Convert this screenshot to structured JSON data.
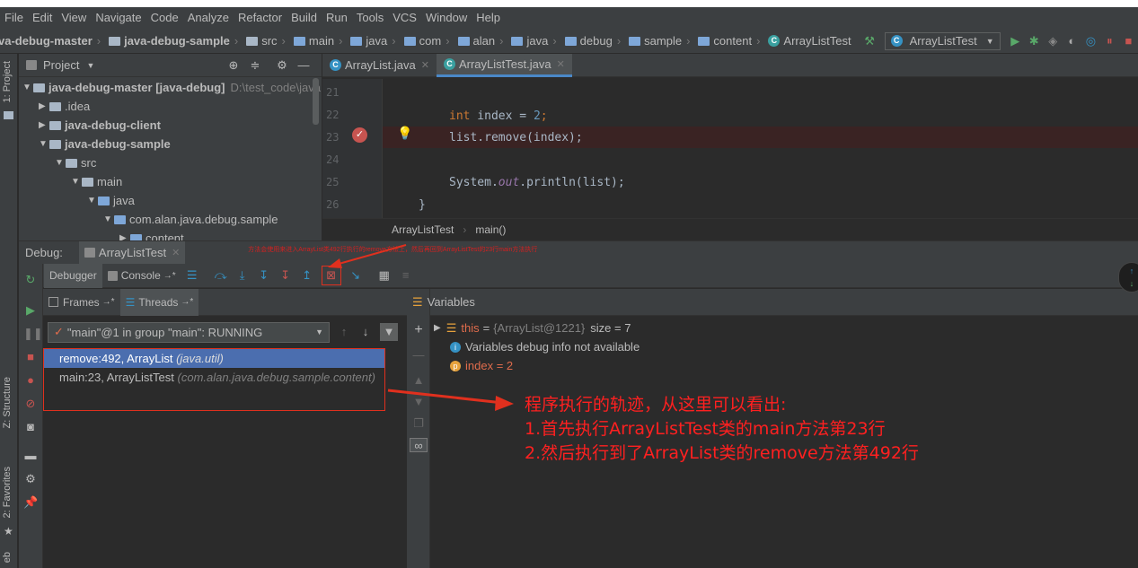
{
  "menu": [
    "File",
    "Edit",
    "View",
    "Navigate",
    "Code",
    "Analyze",
    "Refactor",
    "Build",
    "Run",
    "Tools",
    "VCS",
    "Window",
    "Help"
  ],
  "breadcrumbs": [
    "va-debug-master",
    "java-debug-sample",
    "src",
    "main",
    "java",
    "com",
    "alan",
    "java",
    "debug",
    "sample",
    "content",
    "ArrayListTest"
  ],
  "run_config": "ArrayListTest",
  "project_panel": {
    "title": "Project",
    "tree": [
      {
        "label": "java-debug-master [java-debug]",
        "suffix": "D:\\test_code\\java",
        "indent": 0,
        "expanded": true,
        "bold": true
      },
      {
        "label": ".idea",
        "indent": 1,
        "expanded": false,
        "bold": false
      },
      {
        "label": "java-debug-client",
        "indent": 1,
        "expanded": false,
        "bold": true
      },
      {
        "label": "java-debug-sample",
        "indent": 1,
        "expanded": true,
        "bold": true
      },
      {
        "label": "src",
        "indent": 2,
        "expanded": true,
        "bold": false
      },
      {
        "label": "main",
        "indent": 3,
        "expanded": true,
        "bold": false
      },
      {
        "label": "java",
        "indent": 4,
        "expanded": true,
        "bold": false
      },
      {
        "label": "com.alan.java.debug.sample",
        "indent": 5,
        "expanded": true,
        "bold": false
      },
      {
        "label": "content",
        "indent": 6,
        "expanded": false,
        "bold": false
      }
    ]
  },
  "editor": {
    "tabs": [
      "ArrayList.java",
      "ArrayListTest.java"
    ],
    "line_numbers": [
      "21",
      "22",
      "23",
      "24",
      "25",
      "26"
    ],
    "code": {
      "l22_kw": "int",
      "l22_rest": " index = ",
      "l22_num": "2",
      "l22_end": ";",
      "l23": "list.remove(index);",
      "l25_a": "System.",
      "l25_out": "out",
      "l25_b": ".println(list);",
      "l26": "}"
    },
    "crumb_class": "ArrayListTest",
    "crumb_method": "main()"
  },
  "debug": {
    "label": "Debug:",
    "session": "ArrayListTest",
    "toolbar_tabs": [
      "Debugger",
      "Console"
    ],
    "frames_tab": "Frames",
    "threads_tab": "Threads",
    "thread": "\"main\"@1 in group \"main\": RUNNING",
    "frames": [
      {
        "method": "remove:492, ArrayList",
        "pkg": "(java.util)"
      },
      {
        "method": "main:23, ArrayListTest",
        "pkg": "(com.alan.java.debug.sample.content)"
      }
    ],
    "variables_title": "Variables",
    "variables": {
      "this_name": "this",
      "this_value": "{ArrayList@1221}",
      "this_size": "size = 7",
      "info": "Variables debug info not available",
      "index": "index = 2"
    }
  },
  "side_tabs": [
    "1: Project",
    "Z: Structure",
    "2: Favorites",
    "eb"
  ],
  "annotations": {
    "small_note": "方法会使用来进入ArrayList类492行执行的remove方法上，然后再回到ArrayListTest的23行main方法执行",
    "line1": "程序执行的轨迹，从这里可以看出:",
    "line2": "1.首先执行ArrayListTest类的main方法第23行",
    "line3": "2.然后执行到了ArrayList类的remove方法第492行"
  },
  "colors": {
    "accent": "#4b6eaf",
    "annotation": "#ff2020",
    "background": "#2b2b2b",
    "panel": "#3c3f41"
  }
}
